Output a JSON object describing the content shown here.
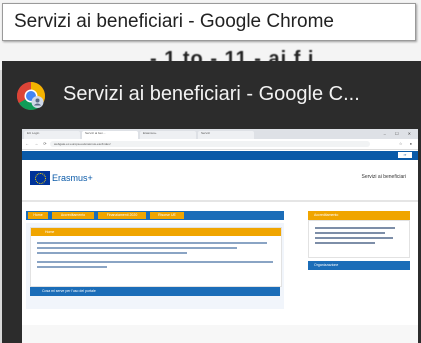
{
  "tooltip": {
    "text": "Servizi ai beneficiari - Google Chrome"
  },
  "background_page": {
    "partial_text": "- 1 to - 11 - ai f i"
  },
  "thumbnail": {
    "title": "Servizi ai beneficiari - Google C...",
    "icon": "chrome-icon",
    "preview": {
      "tabs": [
        "EU Login",
        "Servizi ai ben...",
        "Erasmus+",
        "Servizi"
      ],
      "window_controls": "– ☐ ✕",
      "nav_symbols": "← → ⟳",
      "url": "webgate.ec.europa.eu/erasmus-esc/index/",
      "lang": "IT",
      "brand": "Erasmus+",
      "site_title": "Servizi ai beneficiari",
      "menu": [
        "Home",
        "Accreditamento",
        "Finanziamenti 2020",
        "Risorse UE"
      ],
      "main_heading": "Home",
      "prereq_label": "Cosa mi serve per l'uso del portale",
      "side_heading_1": "Accreditamento",
      "side_heading_2": "Organizzazione",
      "login_label": "Accedi"
    }
  },
  "colors": {
    "eu_blue": "#0a5aa8",
    "orange": "#f0a500",
    "panel_dark": "#2c2c2c"
  }
}
